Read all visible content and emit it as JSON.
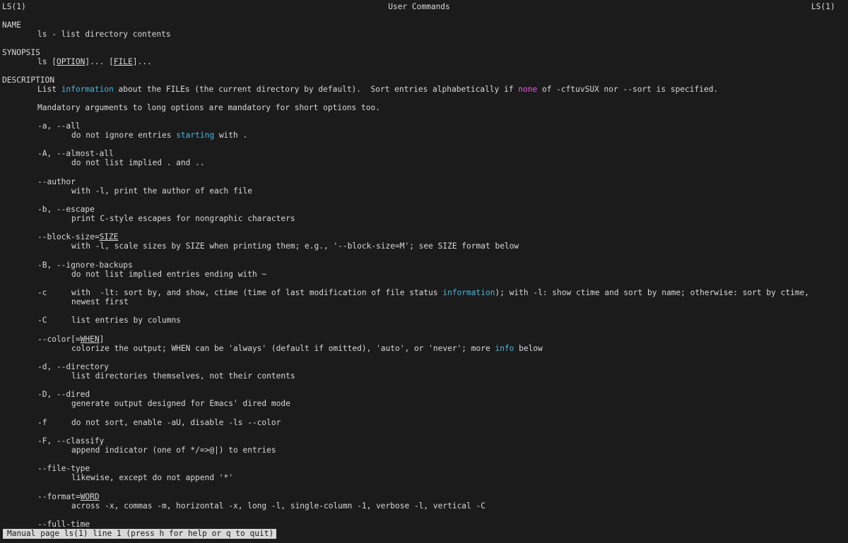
{
  "header": {
    "left": "LS(1)",
    "center": "User Commands",
    "right": "LS(1)"
  },
  "sections": {
    "name_heading": "NAME",
    "name_text": "ls - list directory contents",
    "synopsis_heading": "SYNOPSIS",
    "synopsis_cmd": "ls",
    "synopsis_option": "OPTION",
    "synopsis_file": "FILE",
    "description_heading": "DESCRIPTION",
    "desc1_a": "List ",
    "desc1_b": "information",
    "desc1_c": " about the FILEs (the current directory by default).  Sort entries alphabetically if ",
    "desc1_d": "none",
    "desc1_e": " of -cftuvSUX nor --sort is specified.",
    "desc2": "Mandatory arguments to long options are mandatory for short options too."
  },
  "options": {
    "all_flag": "-a, --all",
    "all_desc_a": "do not ignore entries ",
    "all_desc_b": "starting",
    "all_desc_c": " with .",
    "almost_flag": "-A, --almost-all",
    "almost_desc": "do not list implied . and ..",
    "author_flag": "--author",
    "author_desc": "with -l, print the author of each file",
    "escape_flag": "-b, --escape",
    "escape_desc": "print C-style escapes for nongraphic characters",
    "blocksize_flag": "--block-size=",
    "blocksize_arg": "SIZE",
    "blocksize_desc": "with -l, scale sizes by SIZE when printing them; e.g., '--block-size=M'; see SIZE format below",
    "ignore_flag": "-B, --ignore-backups",
    "ignore_desc": "do not list implied entries ending with ~",
    "c_flag": "-c",
    "c_desc_a": "with  -lt: sort by, and show, ctime (time of last modification of file status ",
    "c_desc_b": "information",
    "c_desc_c": "); with -l: show ctime and sort by name; otherwise: sort by ctime,",
    "c_desc2": "newest first",
    "C_flag": "-C",
    "C_desc": "list entries by columns",
    "color_flag_a": "--color[=",
    "color_flag_arg": "WHEN",
    "color_flag_b": "]",
    "color_desc_a": "colorize the output; WHEN can be 'always' (default if omitted), 'auto', or 'never'; more ",
    "color_desc_b": "info",
    "color_desc_c": " below",
    "directory_flag": "-d, --directory",
    "directory_desc": "list directories themselves, not their contents",
    "dired_flag": "-D, --dired",
    "dired_desc": "generate output designed for Emacs' dired mode",
    "f_flag": "-f",
    "f_desc": "do not sort, enable -aU, disable -ls --color",
    "classify_flag": "-F, --classify",
    "classify_desc": "append indicator (one of */=>@|) to entries",
    "filetype_flag": "--file-type",
    "filetype_desc": "likewise, except do not append '*'",
    "format_flag": "--format=",
    "format_arg": "WORD",
    "format_desc": "across -x, commas -m, horizontal -x, long -l, single-column -1, verbose -l, vertical -C",
    "fulltime_flag": "--full-time"
  },
  "status_bar": {
    "text": "Manual page ls(1) line 1 (press h for help or q to quit)"
  },
  "colors": {
    "background": "#1b1b1b",
    "foreground": "#d8d8d8",
    "highlight_blue": "#4fb4d8",
    "highlight_magenta": "#e05ae0"
  }
}
